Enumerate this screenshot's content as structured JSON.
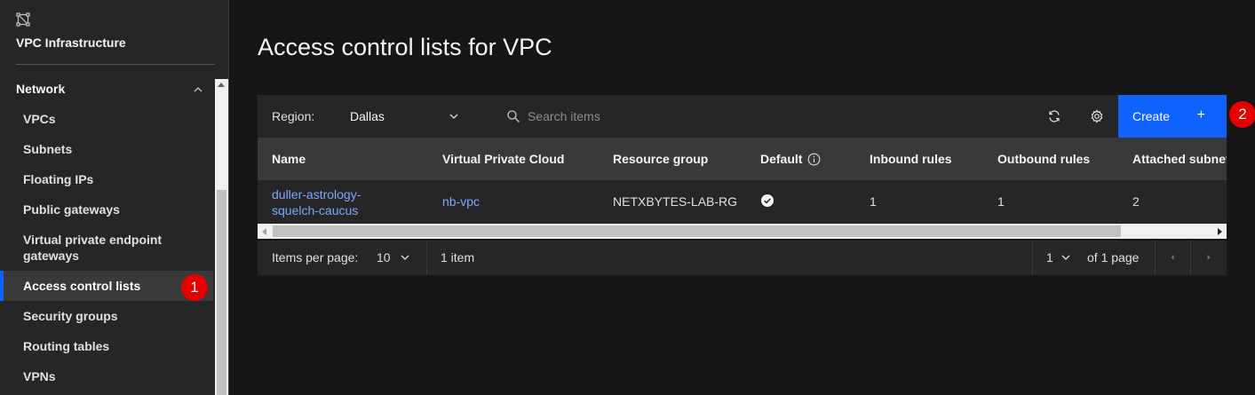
{
  "sidebar": {
    "title": "VPC Infrastructure",
    "section": "Network",
    "items": [
      {
        "label": "VPCs"
      },
      {
        "label": "Subnets"
      },
      {
        "label": "Floating IPs"
      },
      {
        "label": "Public gateways"
      },
      {
        "label": "Virtual private endpoint gateways"
      },
      {
        "label": "Access control lists",
        "active": true
      },
      {
        "label": "Security groups"
      },
      {
        "label": "Routing tables"
      },
      {
        "label": "VPNs"
      }
    ]
  },
  "annotations": [
    "1",
    "2"
  ],
  "page": {
    "title": "Access control lists for VPC"
  },
  "toolbar": {
    "region_label": "Region:",
    "region_value": "Dallas",
    "search_placeholder": "Search items",
    "create_label": "Create",
    "create_icon": "+"
  },
  "table": {
    "headers": [
      "Name",
      "Virtual Private Cloud",
      "Resource group",
      "Default",
      "Inbound rules",
      "Outbound rules",
      "Attached subnets"
    ],
    "rows": [
      {
        "name_line1": "duller-astrology-",
        "name_line2": "squelch-caucus",
        "vpc": "nb-vpc",
        "resource_group": "NETXBYTES-LAB-RG",
        "default": true,
        "inbound": "1",
        "outbound": "1",
        "attached": "2"
      }
    ]
  },
  "pagination": {
    "items_per_page_label": "Items per page:",
    "items_per_page": "10",
    "item_count": "1 item",
    "page": "1",
    "of_pages": "of 1 page"
  },
  "colors": {
    "accent": "#0f62fe",
    "link": "#78a9ff",
    "badge": "#e50000"
  }
}
